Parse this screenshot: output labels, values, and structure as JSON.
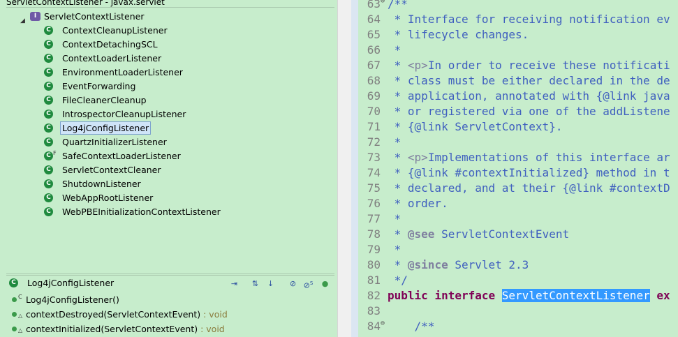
{
  "hierarchy": {
    "title": "ServletContextListener - javax.servlet",
    "root": {
      "label": "ServletContextListener",
      "icon": "interface-icon",
      "badge": "I"
    },
    "items": [
      {
        "label": "ContextCleanupListener"
      },
      {
        "label": "ContextDetachingSCL"
      },
      {
        "label": "ContextLoaderListener"
      },
      {
        "label": "EnvironmentLoaderListener"
      },
      {
        "label": "EventForwarding"
      },
      {
        "label": "FileCleanerCleanup"
      },
      {
        "label": "IntrospectorCleanupListener"
      },
      {
        "label": "Log4jConfigListener"
      },
      {
        "label": "QuartzInitializerListener"
      },
      {
        "label": "SafeContextLoaderListener",
        "modifier": "F"
      },
      {
        "label": "ServletContextCleaner"
      },
      {
        "label": "ShutdownListener"
      },
      {
        "label": "WebAppRootListener"
      },
      {
        "label": "WebPBEInitializationContextListener"
      }
    ],
    "selected_index": 7,
    "class_icon_badge": "C"
  },
  "members": {
    "title": "Log4jConfigListener",
    "toolbar_icons": [
      "lock-view-icon",
      "show-inherited-icon",
      "sort-icon",
      "hide-fields-icon",
      "hide-static-icon",
      "hide-non-public-icon"
    ],
    "static_modifier": "S",
    "items": [
      {
        "modifier": "C",
        "name": "Log4jConfigListener()",
        "type": ""
      },
      {
        "modifier": "△",
        "name": "contextDestroyed(ServletContextEvent)",
        "type": " : void"
      },
      {
        "modifier": "△",
        "name": "contextInitialized(ServletContextEvent)",
        "type": " : void"
      }
    ]
  },
  "editor": {
    "lines": [
      {
        "n": "63",
        "fold": "⊖",
        "text": "/**"
      },
      {
        "n": "64",
        "text": " * Interface for receiving notification ev"
      },
      {
        "n": "65",
        "text": " * lifecycle changes."
      },
      {
        "n": "66",
        "text": " *"
      },
      {
        "n": "67",
        "text": " * <p>In order to receive these notificati"
      },
      {
        "n": "68",
        "text": " * class must be either declared in the de"
      },
      {
        "n": "69",
        "text": " * application, annotated with {@link java"
      },
      {
        "n": "70",
        "text": " * or registered via one of the addListene"
      },
      {
        "n": "71",
        "text": " * {@link ServletContext}."
      },
      {
        "n": "72",
        "text": " *"
      },
      {
        "n": "73",
        "text": " * <p>Implementations of this interface ar"
      },
      {
        "n": "74",
        "text": " * {@link #contextInitialized} method in t"
      },
      {
        "n": "75",
        "text": " * declared, and at their {@link #contextD"
      },
      {
        "n": "76",
        "text": " * order."
      },
      {
        "n": "77",
        "text": " *"
      },
      {
        "n": "78",
        "text": " * @see ServletContextEvent"
      },
      {
        "n": "79",
        "text": " *"
      },
      {
        "n": "80",
        "text": " * @since Servlet 2.3"
      },
      {
        "n": "81",
        "text": " */"
      },
      {
        "n": "82",
        "kw1": "public",
        "kw2": "interface",
        "sel": "ServletContextListener",
        "tail": "ex"
      },
      {
        "n": "83",
        "text": ""
      },
      {
        "n": "84",
        "fold": "⊖",
        "text": "    /**"
      }
    ]
  }
}
